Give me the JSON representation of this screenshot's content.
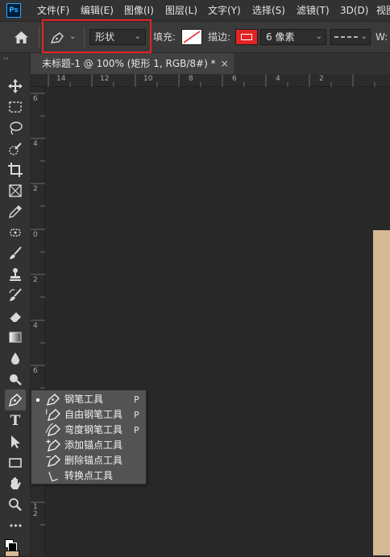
{
  "menubar": {
    "logo": "Ps",
    "items": [
      "文件(F)",
      "编辑(E)",
      "图像(I)",
      "图层(L)",
      "文字(Y)",
      "选择(S)",
      "滤镜(T)",
      "3D(D)",
      "视图"
    ]
  },
  "options": {
    "mode_value": "形状",
    "fill_label": "填充:",
    "stroke_label": "描边:",
    "stroke_width_value": "6 像素",
    "width_label": "W:",
    "highlight_color": "#e32424",
    "stroke_color": "#e32424"
  },
  "document": {
    "tab_title": "未标题-1 @ 100% (矩形 1, RGB/8#) *",
    "tab_close": "×",
    "canvas_color": "#d6b892"
  },
  "rulers": {
    "top": [
      "14",
      "12",
      "10",
      "8",
      "6",
      "4",
      "2"
    ],
    "left": [
      "6",
      "4",
      "2",
      "0",
      "2",
      "4",
      "6",
      "8",
      "1\n0",
      "1\n2"
    ]
  },
  "toolbar": {
    "tools": [
      "move-icon",
      "marquee-icon",
      "lasso-icon",
      "quick-select-icon",
      "crop-icon",
      "frame-icon",
      "eyedropper-icon",
      "healing-icon",
      "brush-icon",
      "stamp-icon",
      "history-brush-icon",
      "eraser-icon",
      "gradient-icon",
      "blur-icon",
      "dodge-icon",
      "pen-icon",
      "type-icon",
      "path-select-icon",
      "rectangle-icon",
      "hand-icon",
      "zoom-icon",
      "more-icon"
    ],
    "type_glyph": "T",
    "more_glyph": "•••"
  },
  "flyout": {
    "items": [
      {
        "label": "钢笔工具",
        "shortcut": "P",
        "selected": true
      },
      {
        "label": "自由钢笔工具",
        "shortcut": "P",
        "selected": false
      },
      {
        "label": "弯度钢笔工具",
        "shortcut": "P",
        "selected": false
      },
      {
        "label": "添加锚点工具",
        "shortcut": "",
        "selected": false
      },
      {
        "label": "删除锚点工具",
        "shortcut": "",
        "selected": false
      },
      {
        "label": "转换点工具",
        "shortcut": "",
        "selected": false
      }
    ]
  }
}
